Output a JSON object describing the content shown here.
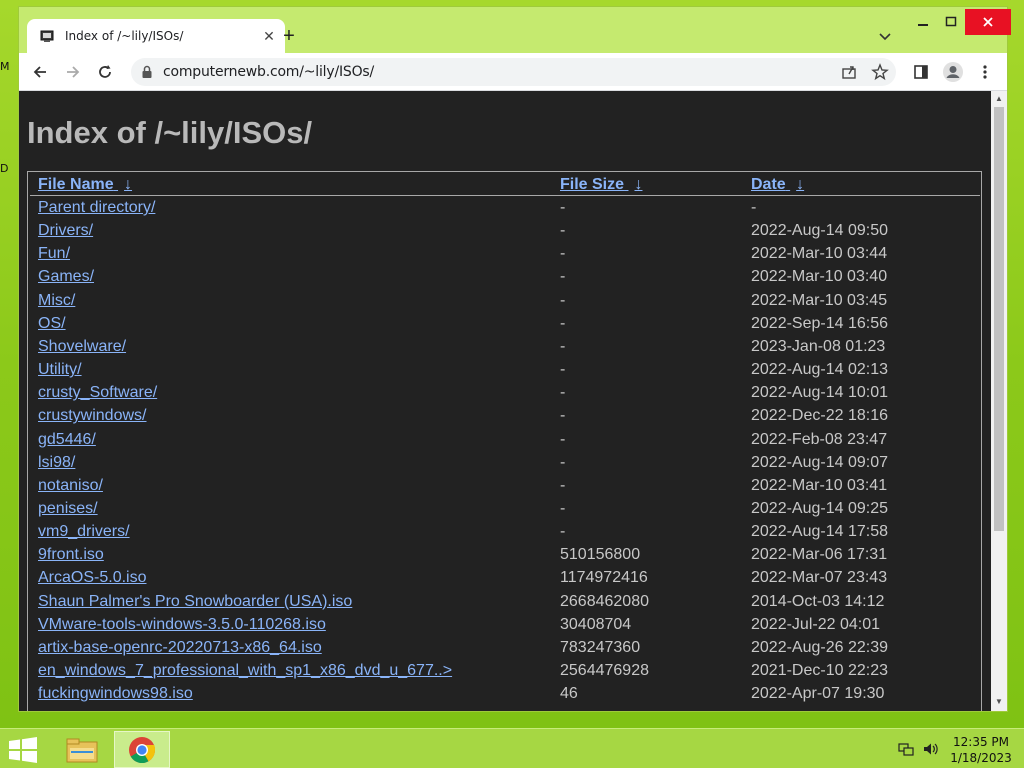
{
  "browser": {
    "tab_title": "Index of /~lily/ISOs/",
    "new_tab_label": "+",
    "url": "computernewb.com/~lily/ISOs/",
    "window_controls": [
      "minimize-icon",
      "maximize-icon",
      "close-icon"
    ]
  },
  "page": {
    "title": "Index of /~lily/ISOs/",
    "headers": {
      "name": "File Name",
      "size": "File Size",
      "date": "Date",
      "sort_glyph": "↓"
    },
    "rows": [
      {
        "name": "Parent directory/",
        "size": "-",
        "date": "-"
      },
      {
        "name": "Drivers/",
        "size": "-",
        "date": "2022-Aug-14 09:50"
      },
      {
        "name": "Fun/",
        "size": "-",
        "date": "2022-Mar-10 03:44"
      },
      {
        "name": "Games/",
        "size": "-",
        "date": "2022-Mar-10 03:40"
      },
      {
        "name": "Misc/",
        "size": "-",
        "date": "2022-Mar-10 03:45"
      },
      {
        "name": "OS/",
        "size": "-",
        "date": "2022-Sep-14 16:56"
      },
      {
        "name": "Shovelware/",
        "size": "-",
        "date": "2023-Jan-08 01:23"
      },
      {
        "name": "Utility/",
        "size": "-",
        "date": "2022-Aug-14 02:13"
      },
      {
        "name": "crusty_Software/",
        "size": "-",
        "date": "2022-Aug-14 10:01"
      },
      {
        "name": "crustywindows/",
        "size": "-",
        "date": "2022-Dec-22 18:16"
      },
      {
        "name": "gd5446/",
        "size": "-",
        "date": "2022-Feb-08 23:47"
      },
      {
        "name": "lsi98/",
        "size": "-",
        "date": "2022-Aug-14 09:07"
      },
      {
        "name": "notaniso/",
        "size": "-",
        "date": "2022-Mar-10 03:41"
      },
      {
        "name": "penises/",
        "size": "-",
        "date": "2022-Aug-14 09:25"
      },
      {
        "name": "vm9_drivers/",
        "size": "-",
        "date": "2022-Aug-14 17:58"
      },
      {
        "name": "9front.iso",
        "size": "510156800",
        "date": "2022-Mar-06 17:31"
      },
      {
        "name": "ArcaOS-5.0.iso",
        "size": "1174972416",
        "date": "2022-Mar-07 23:43"
      },
      {
        "name": "Shaun Palmer's Pro Snowboarder (USA).iso",
        "size": "2668462080",
        "date": "2014-Oct-03 14:12"
      },
      {
        "name": "VMware-tools-windows-3.5.0-110268.iso",
        "size": "30408704",
        "date": "2022-Jul-22 04:01"
      },
      {
        "name": "artix-base-openrc-20220713-x86_64.iso",
        "size": "783247360",
        "date": "2022-Aug-26 22:39"
      },
      {
        "name": "en_windows_7_professional_with_sp1_x86_dvd_u_677..>",
        "size": "2564476928",
        "date": "2021-Dec-10 22:23"
      },
      {
        "name": "fuckingwindows98.iso",
        "size": "46",
        "date": "2022-Apr-07 19:30"
      }
    ]
  },
  "taskbar": {
    "time": "12:35 PM",
    "date": "1/18/2023",
    "apps": [
      "file-explorer-icon",
      "chrome-icon"
    ]
  },
  "colors": {
    "link": "#8ab4f8",
    "page_bg": "#222222",
    "title": "#b9b9b9"
  }
}
